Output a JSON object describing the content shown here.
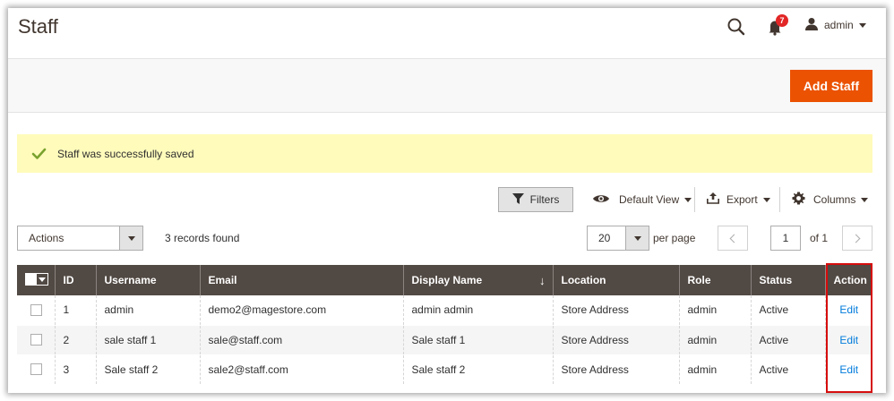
{
  "header": {
    "title": "Staff",
    "notification_count": "7",
    "user_name": "admin"
  },
  "action_band": {
    "add_button": "Add Staff"
  },
  "message": {
    "text": "Staff was successfully saved"
  },
  "toolbar": {
    "filters": "Filters",
    "default_view": "Default View",
    "export": "Export",
    "columns": "Columns"
  },
  "mass_actions": {
    "selected": "Actions",
    "records_found": "3 records found"
  },
  "pager": {
    "per_page_value": "20",
    "per_page_label": "per page",
    "current_page": "1",
    "of_label": "of 1"
  },
  "table": {
    "columns": [
      "ID",
      "Username",
      "Email",
      "Display Name",
      "Location",
      "Role",
      "Status",
      "Action"
    ],
    "sorted_column": "Display Name",
    "sort_indicator": "↓",
    "rows": [
      {
        "id": "1",
        "username": "admin",
        "email": "demo2@magestore.com",
        "display_name": "admin admin",
        "location": "Store Address",
        "role": "admin",
        "status": "Active",
        "action": "Edit"
      },
      {
        "id": "2",
        "username": "sale staff 1",
        "email": "sale@staff.com",
        "display_name": "Sale staff 1",
        "location": "Store Address",
        "role": "admin",
        "status": "Active",
        "action": "Edit"
      },
      {
        "id": "3",
        "username": "Sale staff 2",
        "email": "sale2@staff.com",
        "display_name": "Sale staff 2",
        "location": "Store Address",
        "role": "admin",
        "status": "Active",
        "action": "Edit"
      }
    ]
  },
  "colors": {
    "accent": "#eb5202",
    "table_header": "#514943",
    "link": "#007bdb",
    "success_bg": "#fffbbb",
    "success_icon": "#79a22e",
    "highlight": "#d60d0d"
  }
}
